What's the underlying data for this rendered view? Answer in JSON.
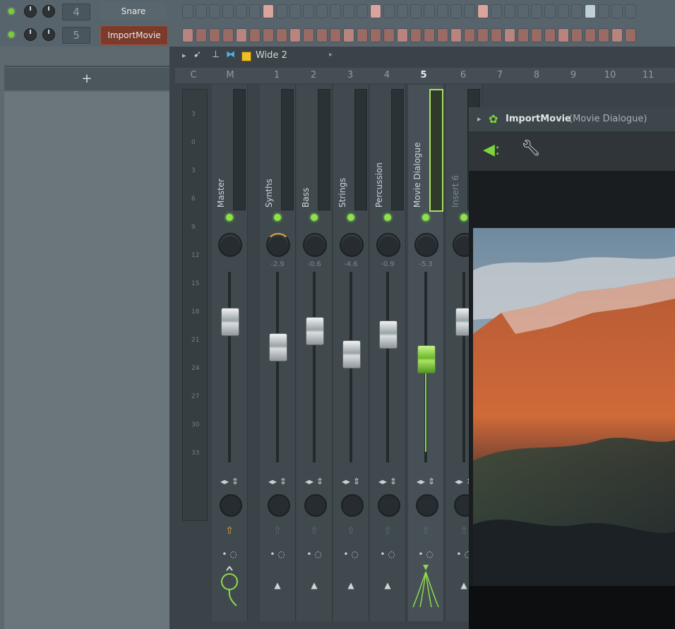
{
  "channel_rack": {
    "rows": [
      {
        "number": "4",
        "name": "Snare",
        "color": "#5a666d"
      },
      {
        "number": "5",
        "name": "ImportMovie",
        "color": "#7a3b2c"
      }
    ],
    "add_label": "+"
  },
  "mixer_toolbar": {
    "layout_label": "Wide 2"
  },
  "mixer": {
    "column_headers": [
      "C",
      "M",
      "1",
      "2",
      "3",
      "4",
      "5",
      "6",
      "7",
      "8",
      "9",
      "10",
      "11"
    ],
    "scale_ticks": [
      "3",
      "0",
      "3",
      "6",
      "9",
      "12",
      "15",
      "18",
      "21",
      "24",
      "27",
      "30",
      "33"
    ],
    "strips": [
      {
        "name": "Master",
        "pan_value": "",
        "fader_level": 0.78,
        "selected": false
      },
      {
        "name": "Synths",
        "pan_value": "-2.9",
        "fader_level": 0.62,
        "selected": false
      },
      {
        "name": "Bass",
        "pan_value": "-0.6",
        "fader_level": 0.72,
        "selected": false
      },
      {
        "name": "Strings",
        "pan_value": "-4.6",
        "fader_level": 0.58,
        "selected": false
      },
      {
        "name": "Percussion",
        "pan_value": "-0.9",
        "fader_level": 0.7,
        "selected": false
      },
      {
        "name": "Movie Dialogue",
        "pan_value": "-5.3",
        "fader_level": 0.55,
        "selected": true
      },
      {
        "name": "Insert 6",
        "pan_value": "",
        "fader_level": 0.78,
        "selected": false
      }
    ]
  },
  "plugin": {
    "title": "ImportMovie",
    "subtitle": "(Movie Dialogue)",
    "accent": "#7ed43a"
  }
}
